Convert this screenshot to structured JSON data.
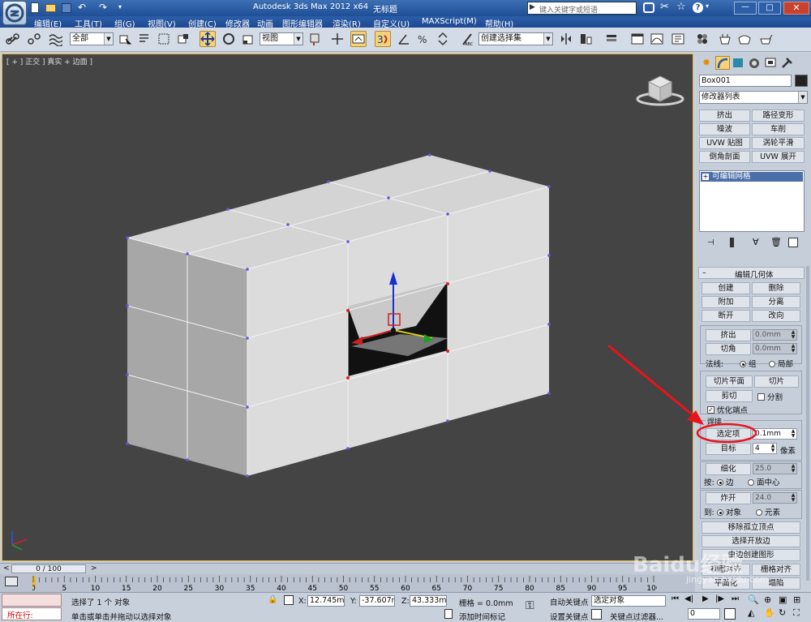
{
  "title_bar": {
    "app_title": "Autodesk 3ds Max  2012 x64",
    "file_name": "无标题",
    "search_placeholder": "键入关键字或短语"
  },
  "menu": [
    "编辑(E)",
    "工具(T)",
    "组(G)",
    "视图(V)",
    "创建(C)",
    "修改器",
    "动画",
    "图形编辑器",
    "渲染(R)",
    "自定义(U)",
    "MAXScript(M)",
    "帮助(H)"
  ],
  "toolbar": {
    "selection_filter": "全部",
    "ref_coord": "视图",
    "named_selection": "创建选择集"
  },
  "viewport": {
    "label": "[ + ] 正交 ] 真实 + 边面 ]",
    "axis_label": "z"
  },
  "command_panel": {
    "object_name": "Box001",
    "modifier_list": "修改器列表",
    "modifier_buttons": [
      "挤出",
      "路径变形",
      "噪波",
      "车削",
      "UVW 贴图",
      "涡轮平滑",
      "倒角剖面",
      "UVW 展开"
    ],
    "stack_item": "可编辑网格",
    "rollout_title": "编辑几何体",
    "geom_buttons": [
      "创建",
      "删除",
      "附加",
      "分离",
      "断开",
      "改向"
    ],
    "extrude_label": "挤出",
    "extrude_value": "0.0mm",
    "chamfer_label": "切角",
    "chamfer_value": "0.0mm",
    "normal_label": "法线:",
    "normal_group": "组",
    "normal_local": "局部",
    "slice_plane": "切片平面",
    "slice": "切片",
    "cut": "剪切",
    "split": "分割",
    "refine_ends": "优化端点",
    "weld_title": "焊接",
    "weld_selected": "选定项",
    "weld_value": "0.1mm",
    "weld_target": "目标",
    "weld_target_value": "4",
    "pixels": "像素",
    "tessellate": "细化",
    "tess_value": "25.0",
    "by_label": "按:",
    "by_edge": "边",
    "by_face_center": "面中心",
    "explode": "炸开",
    "explode_value": "24.0",
    "to_label": "到:",
    "to_object": "对象",
    "to_element": "元素",
    "remove_isolated": "移除孤立顶点",
    "select_open_edges": "选择开放边",
    "create_shape": "由边创建图形",
    "view_align": "视图对齐",
    "grid_align": "栅格对齐",
    "planarize": "平面化",
    "collapse": "塌陷"
  },
  "timeline": {
    "frame": "0 / 100",
    "ticks": [
      "0",
      "5",
      "10",
      "15",
      "20",
      "25",
      "30",
      "35",
      "40",
      "45",
      "50",
      "55",
      "60",
      "65",
      "70",
      "75",
      "80",
      "85",
      "90",
      "95",
      "100"
    ]
  },
  "status": {
    "listener_label": "所在行:",
    "selected": "选择了 1 个 对象",
    "prompt": "单击或单击并拖动以选择对象",
    "x_label": "X:",
    "x_value": "12.745mm",
    "y_label": "Y:",
    "y_value": "-37.607mm",
    "z_label": "Z:",
    "z_value": "43.333mm",
    "grid": "栅格 = 0.0mm",
    "add_time_tag": "添加时间标记",
    "auto_key": "自动关键点",
    "auto_key_value": "选定对象",
    "set_key": "设置关键点",
    "key_filters": "关键点过滤器...",
    "frame_value": "0"
  },
  "watermark": {
    "brand": "Baidu经验",
    "url": "jingyan.baidu.com"
  },
  "colors": {
    "titlebar": "#1e4f96",
    "viewport_bg": "#444444",
    "highlight": "#e8141c",
    "active_button": "#f4d27a"
  }
}
